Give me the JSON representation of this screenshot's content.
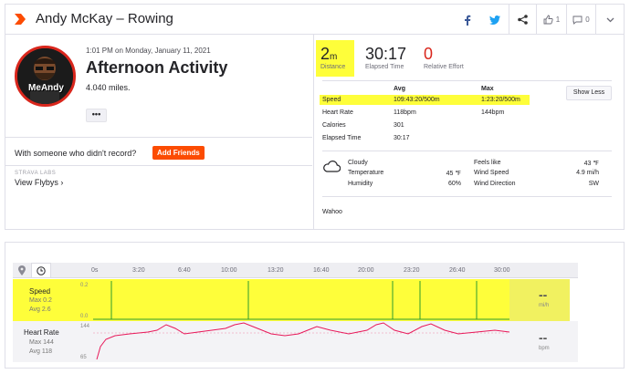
{
  "header": {
    "title": "Andy McKay – Rowing",
    "kudos_count": "1",
    "comments_count": "0"
  },
  "athlete": {
    "avatar_text": "MeAndy",
    "datetime": "1:01 PM on Monday, January 11, 2021",
    "activity_name": "Afternoon Activity",
    "description": "4.040 miles.",
    "more_label": "•••",
    "record_question": "With someone who didn't record?",
    "add_friends_label": "Add Friends",
    "labs_label": "STRAVA LABS",
    "flybys_label": "View Flybys ›"
  },
  "stats": [
    {
      "value": "2",
      "unit": "m",
      "label": "Distance"
    },
    {
      "value": "30:17",
      "unit": "",
      "label": "Elapsed Time"
    },
    {
      "value": "0",
      "unit": "",
      "label": "Relative Effort"
    }
  ],
  "details": {
    "avg_header": "Avg",
    "max_header": "Max",
    "show_less_label": "Show Less",
    "rows": [
      {
        "label": "Speed",
        "avg": "109:43:20/500m",
        "max": "1:23:20/500m"
      },
      {
        "label": "Heart Rate",
        "avg": "118bpm",
        "max": "144bpm"
      },
      {
        "label": "Calories",
        "avg": "301",
        "max": ""
      },
      {
        "label": "Elapsed Time",
        "avg": "30:17",
        "max": ""
      }
    ]
  },
  "weather": {
    "condition": "Cloudy",
    "temperature_label": "Temperature",
    "temperature": "45 ℉",
    "humidity_label": "Humidity",
    "humidity": "60%",
    "feels_like_label": "Feels like",
    "feels_like": "43 ℉",
    "wind_speed_label": "Wind Speed",
    "wind_speed": "4.9 mi/h",
    "wind_direction_label": "Wind Direction",
    "wind_direction": "SW"
  },
  "device": "Wahoo",
  "chart": {
    "ticks": [
      "0s",
      "3:20",
      "6:40",
      "10:00",
      "13:20",
      "16:40",
      "20:00",
      "23:20",
      "26:40",
      "30:00"
    ],
    "speed": {
      "label": "Speed",
      "max": "Max 0.2",
      "avg": "Avg 2.6",
      "y_top": "0.2",
      "y_bottom": "0.0",
      "readout": "--",
      "unit": "mi/h"
    },
    "heart_rate": {
      "label": "Heart Rate",
      "max": "Max 144",
      "avg": "Avg 118",
      "y_top": "144",
      "y_bottom": "65",
      "readout": "--",
      "unit": "bpm"
    }
  },
  "colors": {
    "strava_orange": "#fc4c02",
    "highlight": "#fefe3a",
    "relative_effort_red": "#d9261c",
    "speed_line": "#2d9c2d",
    "hr_line": "#e8195a"
  }
}
